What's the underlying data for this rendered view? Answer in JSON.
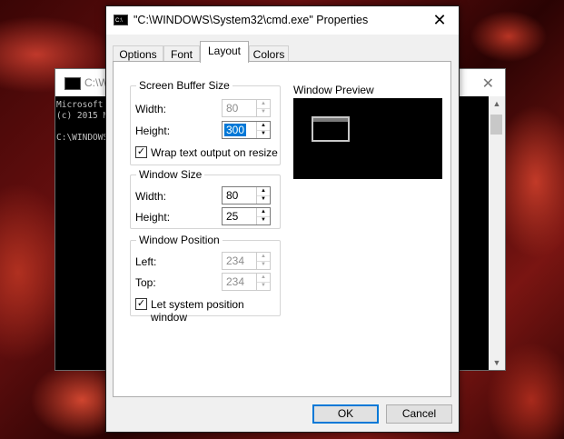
{
  "console": {
    "title": "C:\\W",
    "lines": [
      "Microsoft",
      "(c) 2015 M",
      "",
      "C:\\WINDOWS"
    ]
  },
  "dialog": {
    "title": "\"C:\\WINDOWS\\System32\\cmd.exe\" Properties",
    "close_icon": "close-icon",
    "tabs": [
      {
        "label": "Options",
        "active": false
      },
      {
        "label": "Font",
        "active": false
      },
      {
        "label": "Layout",
        "active": true
      },
      {
        "label": "Colors",
        "active": false
      }
    ],
    "screen_buffer": {
      "legend": "Screen Buffer Size",
      "width_label": "Width:",
      "width_value": "80",
      "width_enabled": false,
      "height_label": "Height:",
      "height_value": "300",
      "height_selected": true,
      "wrap_label": "Wrap text output on resize",
      "wrap_checked": true
    },
    "window_size": {
      "legend": "Window Size",
      "width_label": "Width:",
      "width_value": "80",
      "height_label": "Height:",
      "height_value": "25"
    },
    "window_position": {
      "legend": "Window Position",
      "left_label": "Left:",
      "left_value": "234",
      "top_label": "Top:",
      "top_value": "234",
      "let_system_label": "Let system position window",
      "let_system_checked": true
    },
    "preview": {
      "label": "Window Preview"
    },
    "buttons": {
      "ok": "OK",
      "cancel": "Cancel"
    }
  },
  "colors": {
    "accent": "#0078d7",
    "preview_bg": "#000000",
    "desktop": "#6b1010"
  }
}
